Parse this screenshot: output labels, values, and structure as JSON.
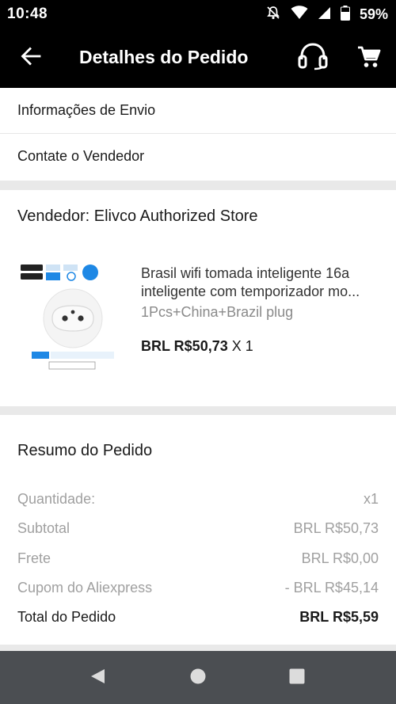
{
  "status_bar": {
    "time": "10:48",
    "battery_percent": "59%",
    "icons": [
      "do-not-disturb-icon",
      "wifi-icon",
      "signal-icon",
      "battery-icon"
    ]
  },
  "app_bar": {
    "title": "Detalhes do Pedido",
    "icons": [
      "back-arrow-icon",
      "headset-icon",
      "cart-icon"
    ]
  },
  "links": {
    "shipping_info": "Informações de Envio",
    "contact_seller": "Contate o Vendedor"
  },
  "order": {
    "seller_label": "Vendedor: Elivco Authorized Store",
    "product": {
      "title_line1": "Brasil wifi tomada inteligente 16a",
      "title_line2": "inteligente com temporizador mo...",
      "variant": "1Pcs+China+Brazil plug",
      "price": "BRL R$50,73",
      "quantity": " X 1",
      "thumb_badge": "16A",
      "thumb_caption": "WiFi Energy Monitor Function",
      "thumb_subcaption": "Brazil Plug×1Pcs"
    }
  },
  "summary": {
    "title": "Resumo do Pedido",
    "rows": [
      {
        "label": "Quantidade:",
        "value": "x1"
      },
      {
        "label": "Subtotal",
        "value": "BRL R$50,73"
      },
      {
        "label": "Frete",
        "value": "BRL R$0,00"
      },
      {
        "label": "Cupom do Aliexpress",
        "value": "- BRL R$45,14"
      }
    ],
    "total": {
      "label": "Total do Pedido",
      "value": "BRL R$5,59"
    }
  },
  "colors": {
    "bar_background": "#000000",
    "nav_background": "#4b4e52",
    "page_background": "#e9e9e9",
    "muted_text": "#a0a0a0"
  }
}
